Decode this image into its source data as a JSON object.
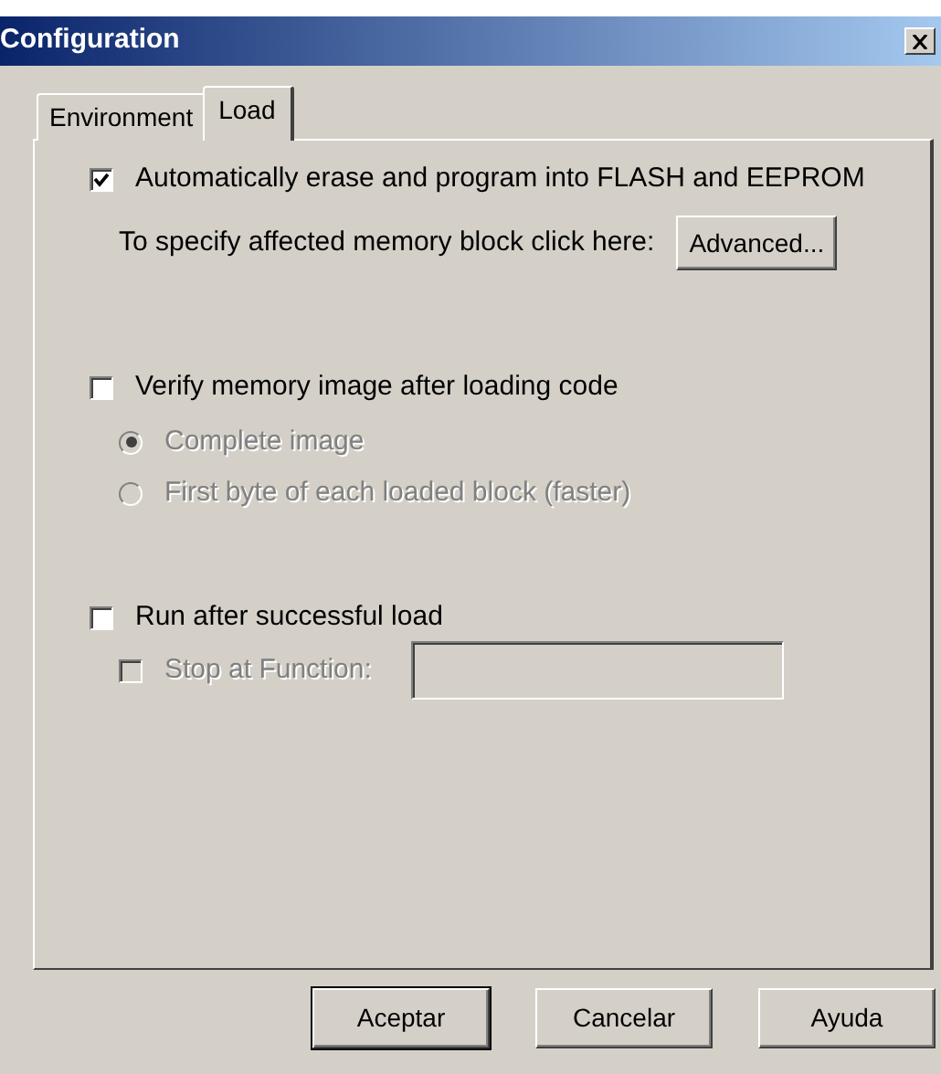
{
  "window": {
    "title": "Configuration"
  },
  "tabs": [
    {
      "label": "Environment",
      "selected": false
    },
    {
      "label": "Load",
      "selected": true
    }
  ],
  "groups": [
    {
      "kind": "checkbox",
      "label": "Automatically erase and program into FLASH and EEPROM",
      "checked": true,
      "disabled": false,
      "children": [
        {
          "kind": "note",
          "label": "To specify affected memory block click here:",
          "button": "Advanced..."
        }
      ]
    },
    {
      "kind": "checkbox",
      "label": "Verify memory image after loading code",
      "checked": false,
      "disabled": false,
      "children": [
        {
          "kind": "radio",
          "label": "Complete image",
          "selected": true,
          "disabled": true
        },
        {
          "kind": "radio",
          "label": "First byte of each loaded block (faster)",
          "selected": false,
          "disabled": true
        }
      ]
    },
    {
      "kind": "checkbox",
      "label": "Run after successful load",
      "checked": false,
      "disabled": false,
      "children": [
        {
          "kind": "checkfield",
          "label": "Stop at Function:",
          "checked": false,
          "disabled": true
        }
      ]
    }
  ],
  "buttons": [
    {
      "label": "Aceptar",
      "default": true
    },
    {
      "label": "Cancelar",
      "default": false
    },
    {
      "label": "Ayuda",
      "default": false
    }
  ]
}
